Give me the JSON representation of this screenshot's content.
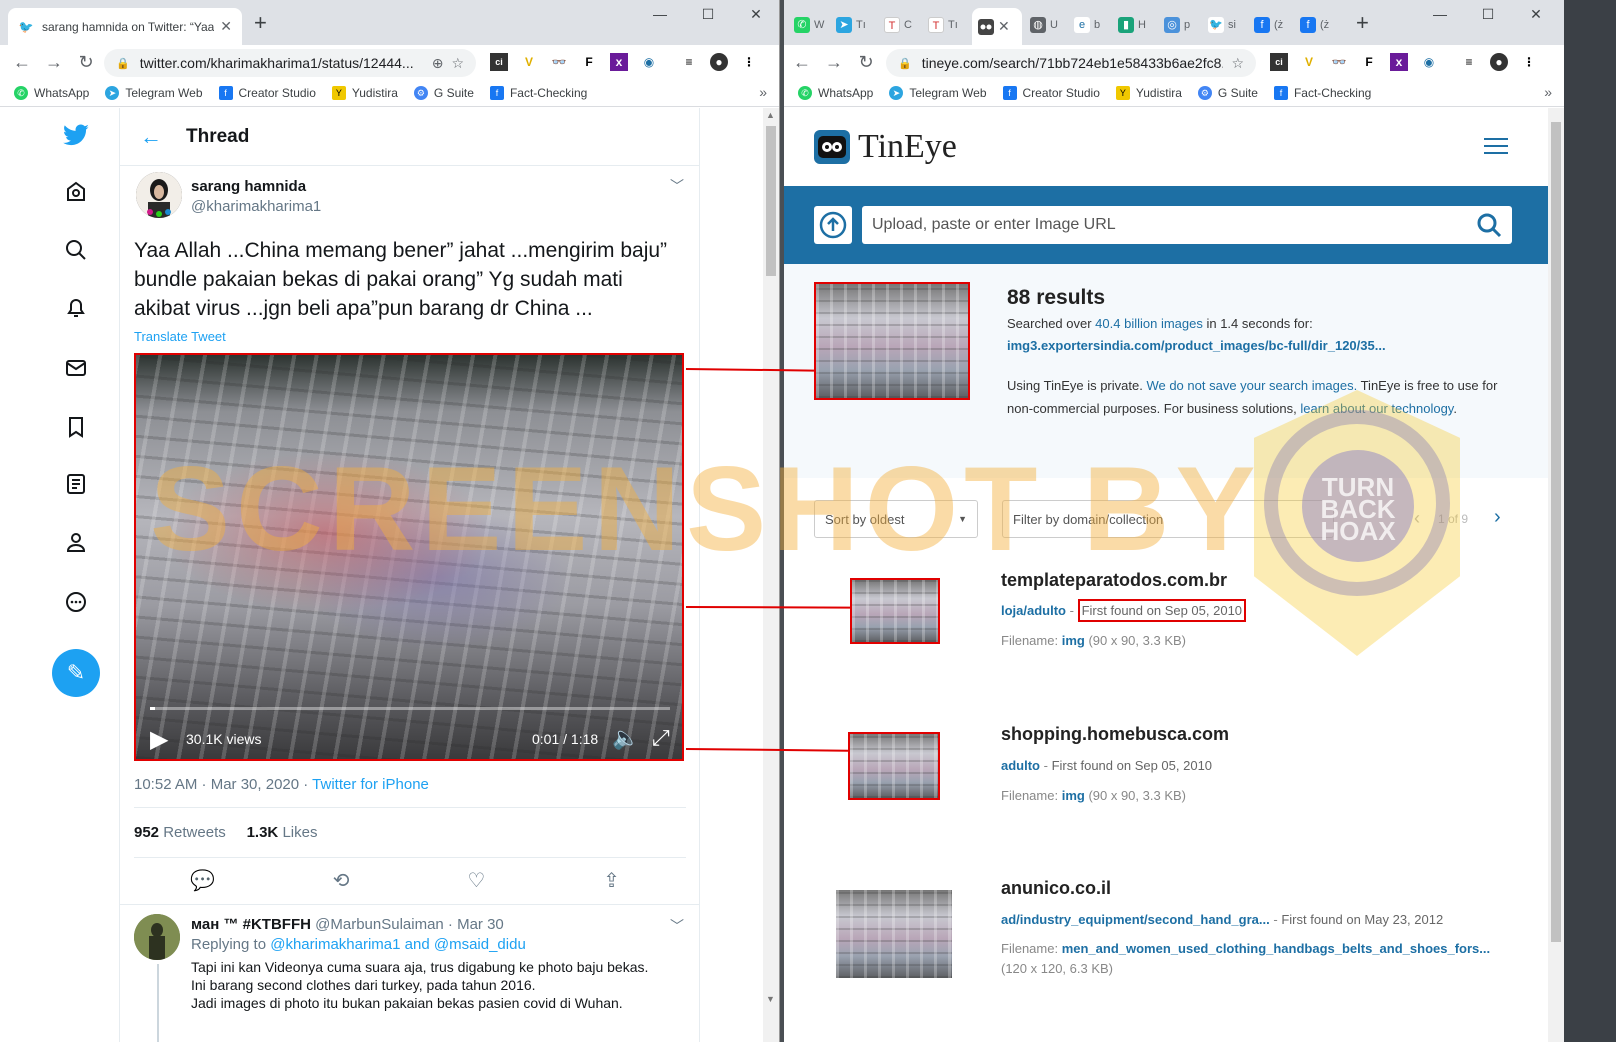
{
  "left": {
    "tab_title": "sarang hamnida on Twitter: “Yaa",
    "url": "twitter.com/kharimakharima1/status/12444...",
    "bookmarks": [
      "WhatsApp",
      "Telegram Web",
      "Creator Studio",
      "Yudistira",
      "G Suite",
      "Fact-Checking"
    ],
    "header_title": "Thread",
    "author_name": "sarang hamnida",
    "author_handle": "@kharimakharima1",
    "tweet_text": "Yaa Allah ...China memang bener” jahat ...mengirim baju” bundle pakaian bekas di pakai orang” Yg sudah mati akibat virus ...jgn beli apa”pun barang dr China ...",
    "translate": "Translate Tweet",
    "video_views": "30.1K views",
    "video_time": "0:01 / 1:18",
    "timestamp": "10:52 AM · Mar 30, 2020 · ",
    "source": "Twitter for iPhone",
    "retweets_count": "952",
    "retweets_label": "Retweets",
    "likes_count": "1.3K",
    "likes_label": "Likes",
    "reply_name": "ман ™ #KTBFFH",
    "reply_meta": "@MarbunSulaiman · Mar 30",
    "reply_to_prefix": "Replying to ",
    "reply_to_users": "@kharimakharima1 and @msaid_didu",
    "reply_lines": [
      "Tapi ini kan Videonya cuma suara aja, trus digabung ke photo baju bekas.",
      "Ini barang second clothes dari turkey, pada tahun 2016.",
      "Jadi images di photo itu bukan pakaian bekas pasien covid di Wuhan."
    ]
  },
  "right": {
    "url": "tineye.com/search/71bb724eb1e58433b6ae2fc8...",
    "bookmarks": [
      "WhatsApp",
      "Telegram Web",
      "Creator Studio",
      "Yudistira",
      "G Suite",
      "Fact-Checking"
    ],
    "logo": "TinEye",
    "search_placeholder": "Upload, paste or enter Image URL",
    "results_count": "88 results",
    "searched_prefix": "Searched over ",
    "searched_count": "40.4 billion images",
    "searched_suffix": " in 1.4 seconds for:",
    "source_url": "img3.exportersindia.com/product_images/bc-full/dir_120/35...",
    "privacy_a": "Using TinEye is private. ",
    "privacy_b": "We do not save your search images.",
    "privacy_c": " TinEye is free to use for non-commercial purposes. For business solutions, ",
    "privacy_d": "learn about our technology",
    "privacy_e": ".",
    "sort_label": "Sort by oldest",
    "filter_placeholder": "Filter by domain/collection",
    "pagination": "1 of 9",
    "results": [
      {
        "domain": "templateparatodos.com.br",
        "path": "loja/adulto",
        "found": "First found on Sep 05, 2010",
        "fname_label": "Filename: ",
        "fname": "img",
        "fname_meta": " (90 x 90, 3.3 KB)"
      },
      {
        "domain": "shopping.homebusca.com",
        "path": "adulto",
        "found": "First found on Sep 05, 2010",
        "fname_label": "Filename: ",
        "fname": "img",
        "fname_meta": " (90 x 90, 3.3 KB)"
      },
      {
        "domain": "anunico.co.il",
        "path": "ad/industry_equipment/second_hand_gra...",
        "found": "First found on May 23, 2012",
        "fname_label": "Filename: ",
        "fname": "men_and_women_used_clothing_handbags_belts_and_shoes_fors...",
        "fname_meta": "(120 x 120, 6.3 KB)"
      }
    ]
  },
  "watermark": "SCREENSHOT BY",
  "stamp_text": "TURN BACK HOAX",
  "colors": {
    "twitter_blue": "#1da1f2",
    "tineye_blue": "#1d6fa4",
    "highlight_red": "#e00000"
  }
}
